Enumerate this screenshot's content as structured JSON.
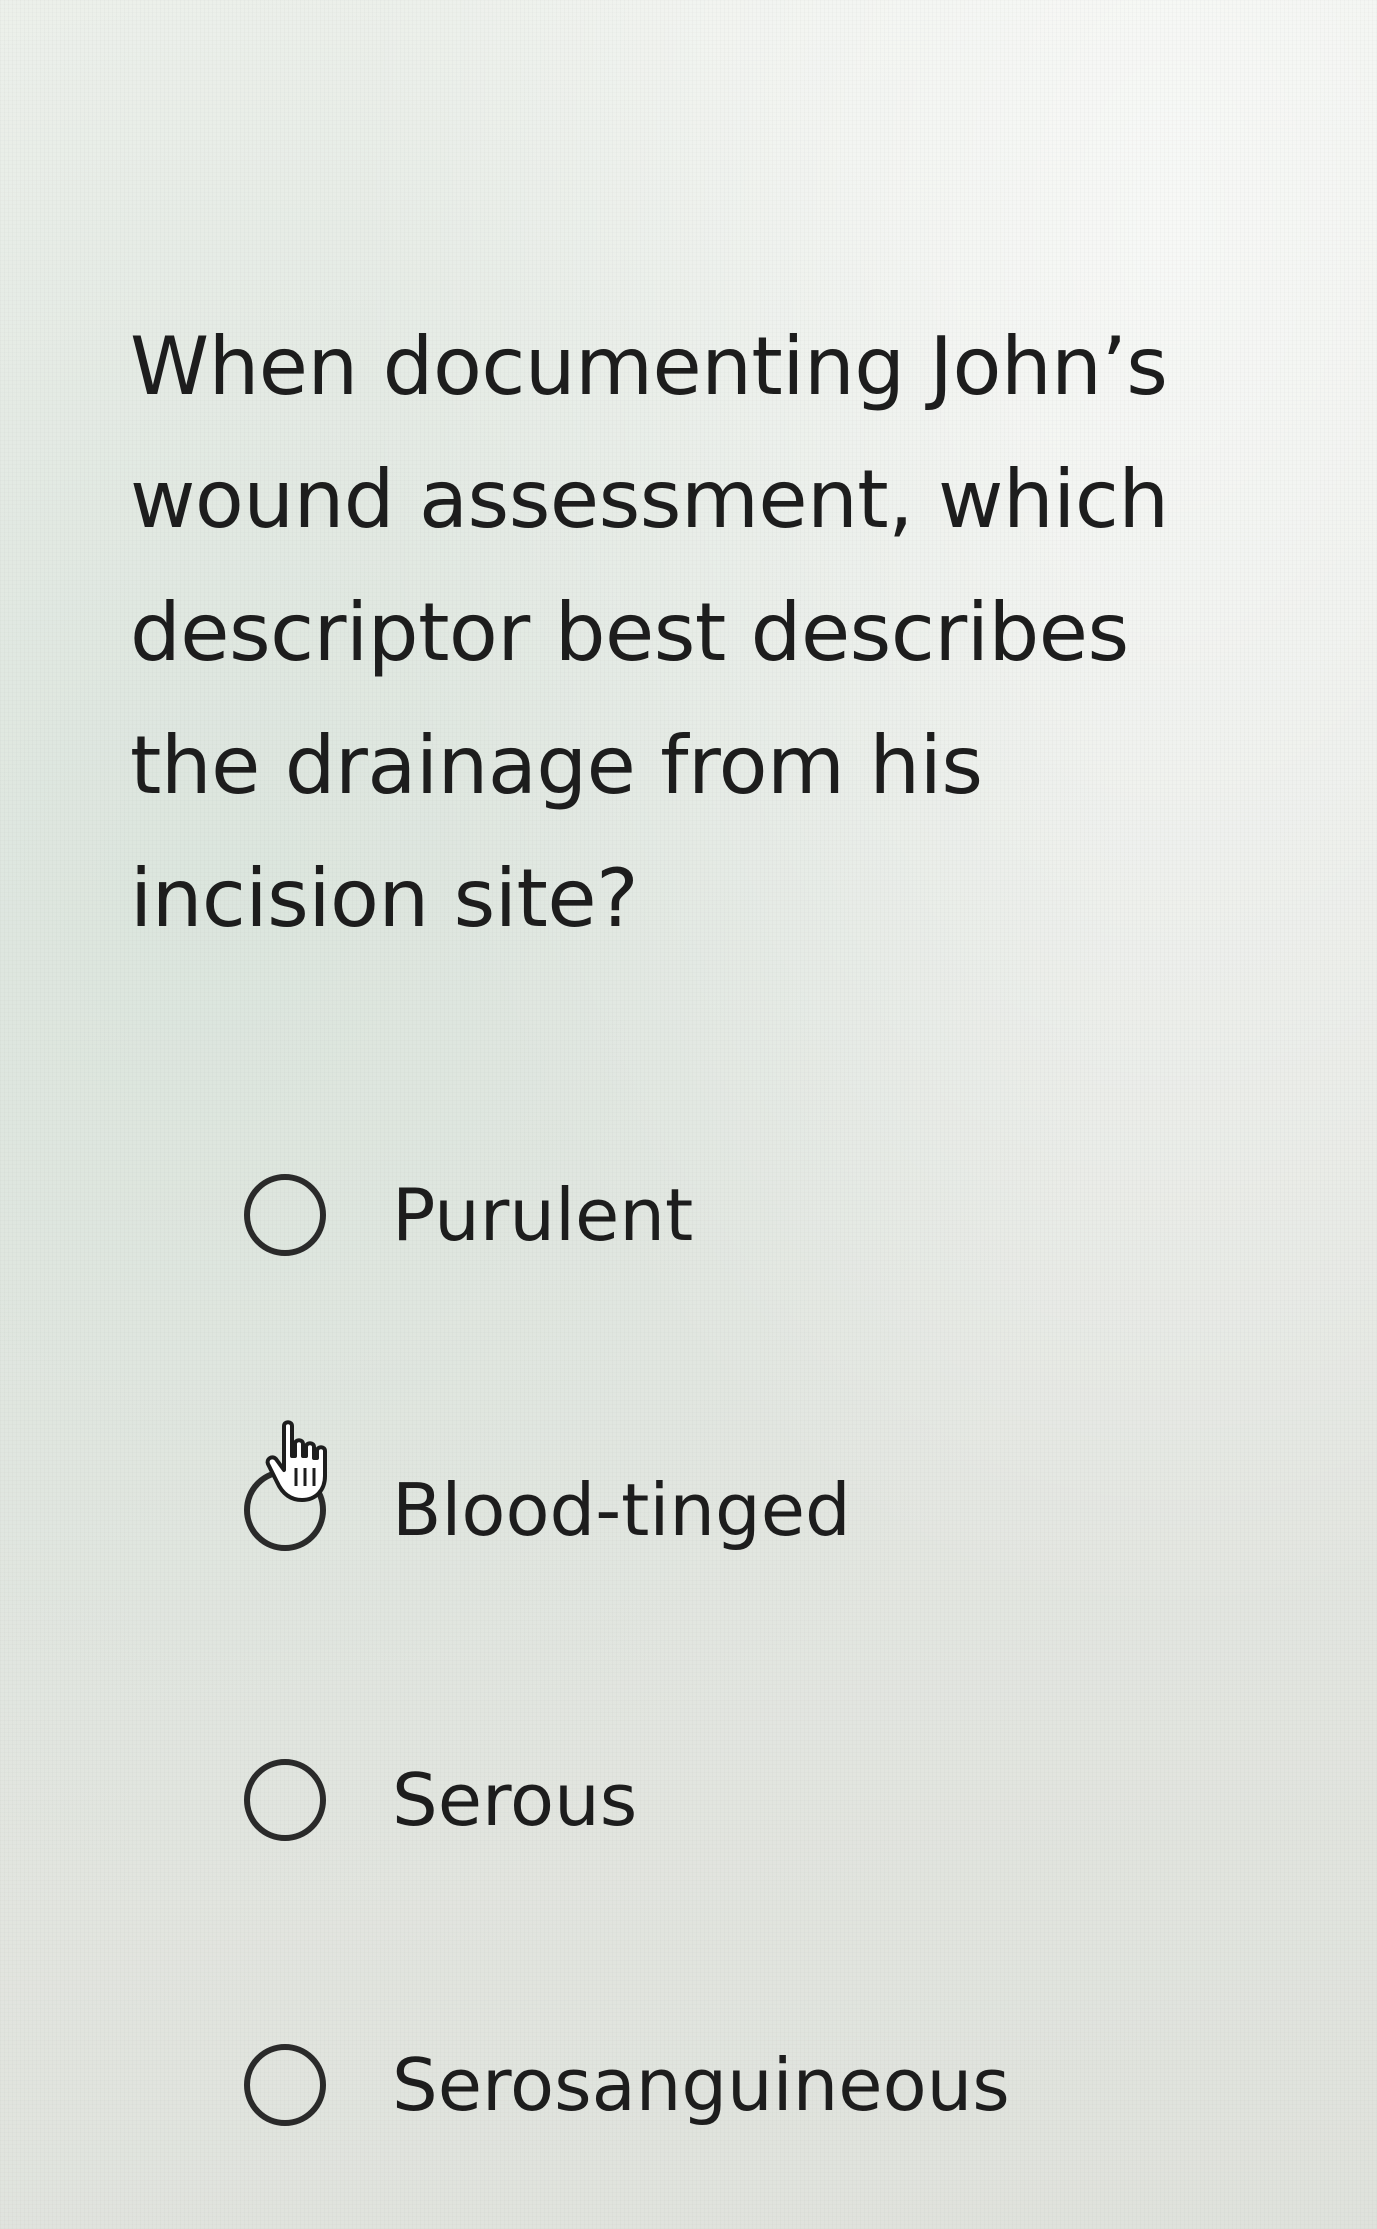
{
  "question": {
    "text": "When documenting John’s wound assessment, which descriptor best describes the drainage from his incision site?"
  },
  "options": [
    {
      "label": "Purulent",
      "selected": false
    },
    {
      "label": "Blood-tinged",
      "selected": false
    },
    {
      "label": "Serous",
      "selected": false
    },
    {
      "label": "Serosanguineous",
      "selected": false
    }
  ],
  "cursor": {
    "icon": "hand-pointer-icon"
  },
  "colors": {
    "text": "#1d1d1d",
    "radio_border": "#2a2a2a",
    "background": "#e6e9e4"
  }
}
